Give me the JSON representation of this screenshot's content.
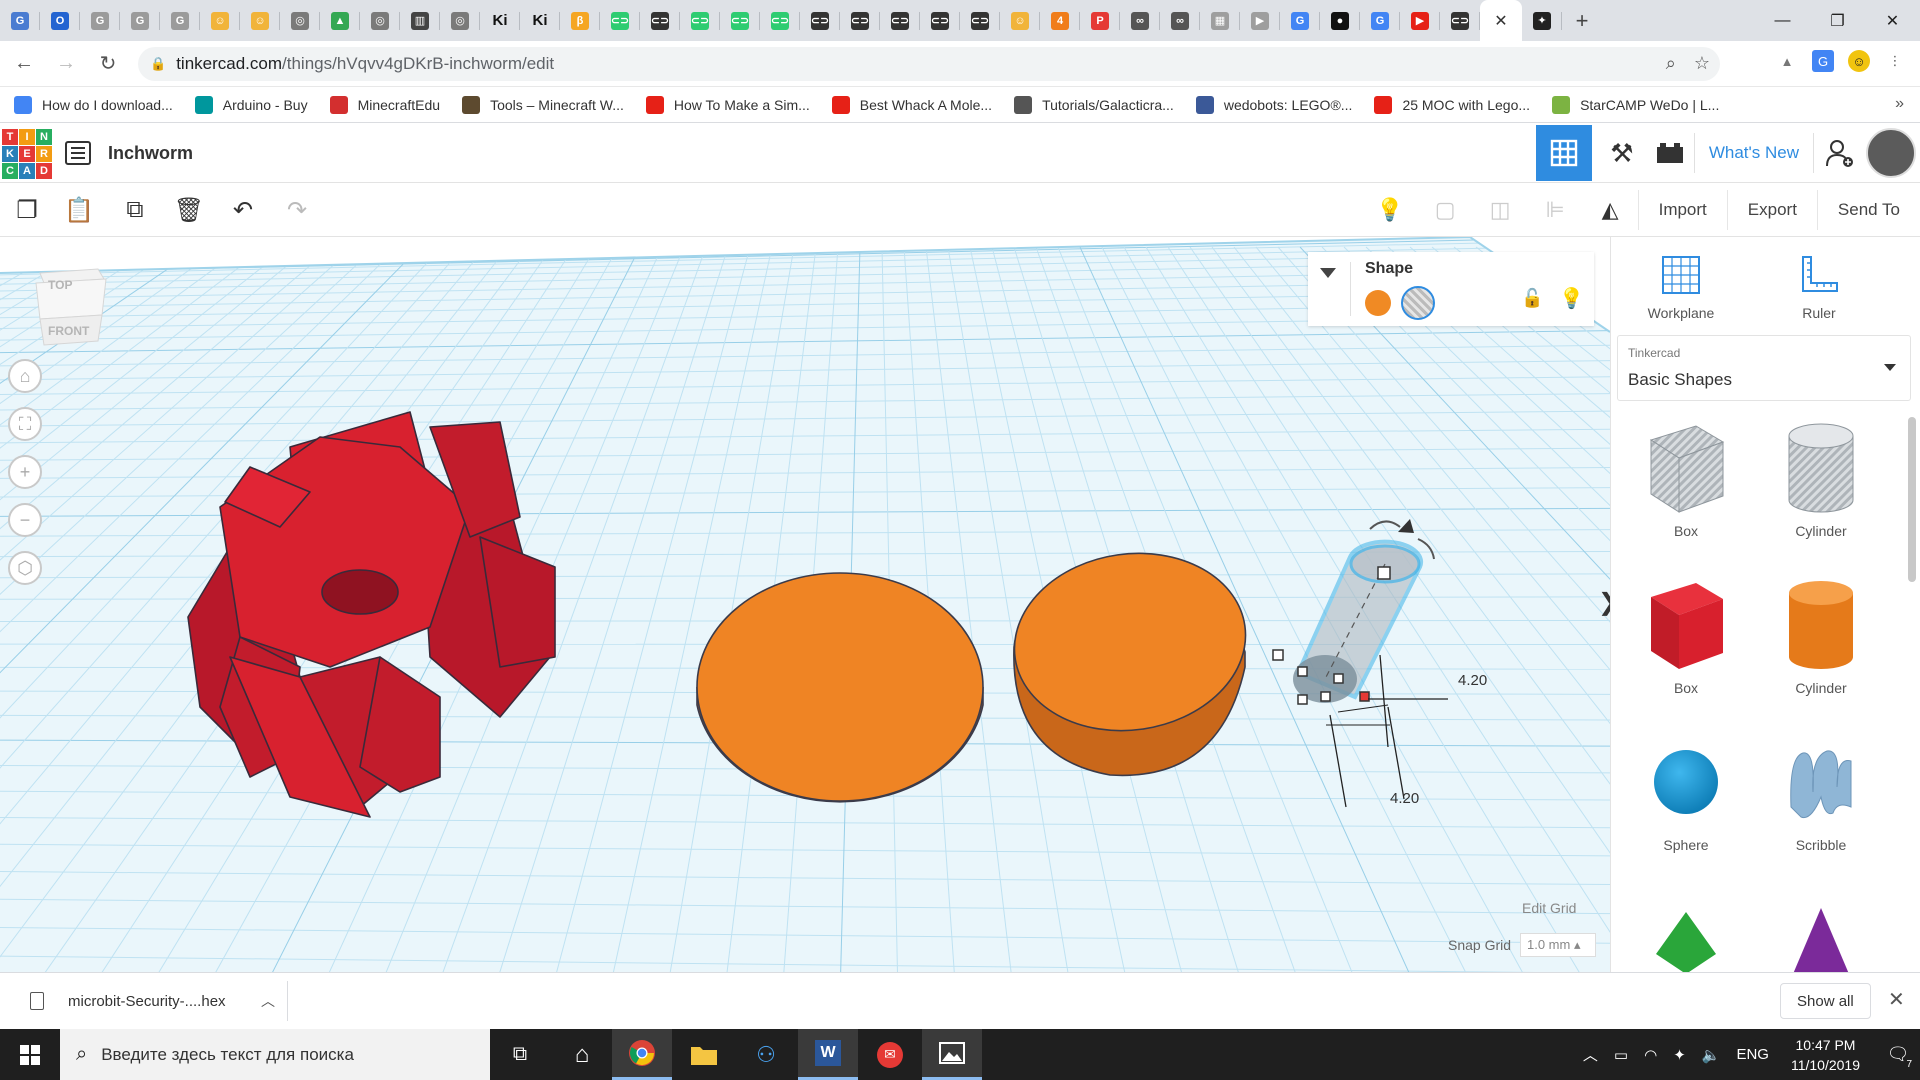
{
  "browser": {
    "tab_favicons": [
      {
        "color": "#4a7cd1",
        "glyph": "G"
      },
      {
        "color": "#2364d1",
        "glyph": "O"
      },
      {
        "color": "#9b9b9b",
        "glyph": "G"
      },
      {
        "color": "#9b9b9b",
        "glyph": "G"
      },
      {
        "color": "#9b9b9b",
        "glyph": "G"
      },
      {
        "color": "#f1b43a",
        "glyph": "☺"
      },
      {
        "color": "#f1b43a",
        "glyph": "☺"
      },
      {
        "color": "#7a7a7a",
        "glyph": "◎"
      },
      {
        "color": "#34a853",
        "glyph": "▲"
      },
      {
        "color": "#7a7a7a",
        "glyph": "◎"
      },
      {
        "color": "#444",
        "glyph": "▥"
      },
      {
        "color": "#7a7a7a",
        "glyph": "◎"
      },
      {
        "color": "#dee1e6",
        "glyph": "Ki"
      },
      {
        "color": "#dee1e6",
        "glyph": "Ki"
      },
      {
        "color": "#f5a623",
        "glyph": "β"
      },
      {
        "color": "#2ecc71",
        "glyph": "⊂⊃"
      },
      {
        "color": "#333",
        "glyph": "⊂⊃"
      },
      {
        "color": "#2ecc71",
        "glyph": "⊂⊃"
      },
      {
        "color": "#2ecc71",
        "glyph": "⊂⊃"
      },
      {
        "color": "#2ecc71",
        "glyph": "⊂⊃"
      },
      {
        "color": "#333",
        "glyph": "⊂⊃"
      },
      {
        "color": "#333",
        "glyph": "⊂⊃"
      },
      {
        "color": "#333",
        "glyph": "⊂⊃"
      },
      {
        "color": "#333",
        "glyph": "⊂⊃"
      },
      {
        "color": "#333",
        "glyph": "⊂⊃"
      },
      {
        "color": "#f1b43a",
        "glyph": "☺"
      },
      {
        "color": "#f07d1a",
        "glyph": "4"
      },
      {
        "color": "#e53935",
        "glyph": "P"
      },
      {
        "color": "#555",
        "glyph": "∞"
      },
      {
        "color": "#555",
        "glyph": "∞"
      },
      {
        "color": "#9e9e9e",
        "glyph": "▦"
      },
      {
        "color": "#9e9e9e",
        "glyph": "▶"
      },
      {
        "color": "#4285f4",
        "glyph": "G"
      },
      {
        "color": "#111",
        "glyph": "●"
      },
      {
        "color": "#4285f4",
        "glyph": "G"
      },
      {
        "color": "#e62117",
        "glyph": "▶"
      },
      {
        "color": "#333",
        "glyph": "⊂⊃"
      }
    ],
    "active_tab_close": "✕",
    "active_tab_favicon": "✦",
    "new_tab": "+",
    "window_controls": [
      "—",
      "❐",
      "✕"
    ],
    "url_host": "tinkercad.com",
    "url_path": "/things/hVqvv4gDKrB-inchworm/edit",
    "bookmarks": [
      {
        "label": "How do I download...",
        "color": "#4285f4"
      },
      {
        "label": "Arduino - Buy",
        "color": "#00979d"
      },
      {
        "label": "MinecraftEdu",
        "color": "#d32f2f"
      },
      {
        "label": "Tools – Minecraft W...",
        "color": "#5d4a2f"
      },
      {
        "label": "How To Make a Sim...",
        "color": "#e62117"
      },
      {
        "label": "Best Whack A Mole...",
        "color": "#e62117"
      },
      {
        "label": "Tutorials/Galacticra...",
        "color": "#555"
      },
      {
        "label": "wedobots: LEGO®...",
        "color": "#3b5998"
      },
      {
        "label": "25 MOC with Lego...",
        "color": "#e62117"
      },
      {
        "label": "StarCAMP WeDo | L...",
        "color": "#7cb342"
      }
    ],
    "bookmarks_more": "»"
  },
  "tinkercad": {
    "logo_letters": [
      "T",
      "I",
      "N",
      "K",
      "E",
      "R",
      "C",
      "A",
      "D"
    ],
    "logo_colors": [
      "#e53935",
      "#f39c12",
      "#27ae60",
      "#2980b9",
      "#e53935",
      "#f39c12",
      "#27ae60",
      "#2980b9",
      "#e53935"
    ],
    "design_title": "Inchworm",
    "whats_new": "What's New",
    "import_label": "Import",
    "export_label": "Export",
    "send_to_label": "Send To",
    "viewcube_top": "TOP",
    "viewcube_front": "FRONT",
    "shape_panel": {
      "title": "Shape",
      "solid_color": "#f08a24"
    },
    "dimension_width": "4.20",
    "dimension_length": "4.20",
    "edit_grid": "Edit Grid",
    "snap_grid_label": "Snap Grid",
    "snap_grid_value": "1.0 mm ▴",
    "right_panel": {
      "workplane": "Workplane",
      "ruler": "Ruler",
      "library_vendor": "Tinkercad",
      "library_name": "Basic Shapes",
      "shapes": [
        {
          "label": "Box",
          "kind": "hole-box"
        },
        {
          "label": "Cylinder",
          "kind": "hole-cylinder"
        },
        {
          "label": "Box",
          "kind": "red-box"
        },
        {
          "label": "Cylinder",
          "kind": "orange-cylinder"
        },
        {
          "label": "Sphere",
          "kind": "sphere"
        },
        {
          "label": "Scribble",
          "kind": "scribble"
        }
      ]
    },
    "colors": {
      "accent": "#2f8ce0",
      "red_shape": "#d01f2b",
      "orange_shape": "#f08a24",
      "grid": "#c7e7f5"
    }
  },
  "download_bar": {
    "file_name": "microbit-Security-....hex",
    "show_all": "Show all",
    "close": "✕"
  },
  "taskbar": {
    "search_placeholder": "Введите здесь текст для поиска",
    "language": "ENG",
    "time": "10:47 PM",
    "date": "11/10/2019",
    "notification_count": "7"
  }
}
